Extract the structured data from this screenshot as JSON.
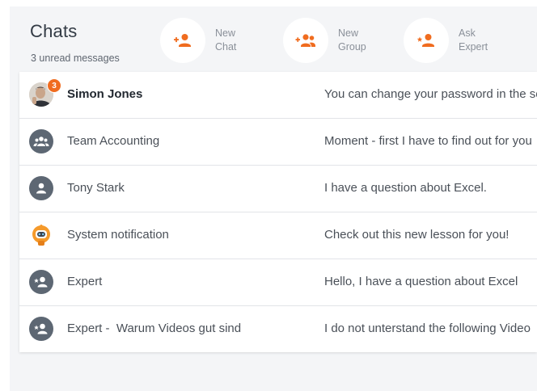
{
  "header": {
    "title": "Chats",
    "subtitle": "3 unread messages"
  },
  "actions": [
    {
      "line1": "New",
      "line2": "Chat",
      "icon": "add-person-icon"
    },
    {
      "line1": "New",
      "line2": "Group",
      "icon": "add-group-icon"
    },
    {
      "line1": "Ask",
      "line2": "Expert",
      "icon": "ask-expert-icon"
    }
  ],
  "chats": [
    {
      "name": "Simon Jones",
      "preview": "You can change your password in the settings",
      "unread": true,
      "badge": "3",
      "avatar": "user-photo"
    },
    {
      "name": "Team Accounting",
      "preview": "Moment - first I have to find out for you",
      "unread": false,
      "avatar": "group-icon"
    },
    {
      "name": "Tony Stark",
      "preview": "I have a question about Excel.",
      "unread": false,
      "avatar": "person-icon"
    },
    {
      "name": "System notification",
      "preview": "Check out this new lesson for you!",
      "unread": false,
      "avatar": "robot-icon"
    },
    {
      "name": "Expert",
      "preview": "Hello, I have a question about Excel",
      "unread": false,
      "avatar": "expert-icon"
    },
    {
      "name": "Expert -  Warum Videos gut sind",
      "preview": "I do not unterstand the following Video",
      "unread": false,
      "avatar": "expert-icon"
    }
  ],
  "colors": {
    "accent": "#f06c1f",
    "avatar": "#5d6773",
    "panel": "#f4f5f7"
  }
}
